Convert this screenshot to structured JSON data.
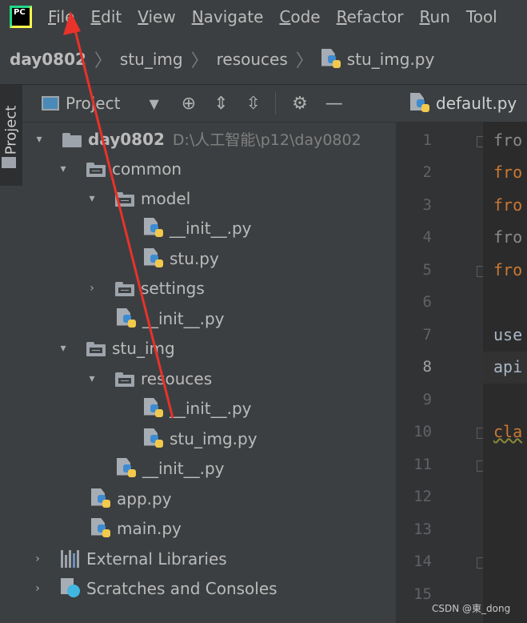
{
  "menubar": {
    "logo_text": "PC",
    "items": [
      {
        "mnemonic": "F",
        "rest": "ile"
      },
      {
        "mnemonic": "E",
        "rest": "dit"
      },
      {
        "mnemonic": "V",
        "rest": "iew"
      },
      {
        "mnemonic": "N",
        "rest": "avigate"
      },
      {
        "mnemonic": "C",
        "rest": "ode"
      },
      {
        "mnemonic": "R",
        "rest": "efactor"
      },
      {
        "mnemonic": "R",
        "rest": "un"
      },
      {
        "mnemonic": "",
        "rest": "Tool"
      }
    ]
  },
  "breadcrumb": [
    "day0802",
    "stu_img",
    "resouces",
    "stu_img.py"
  ],
  "sidebar_tab": "Project",
  "project_panel": {
    "title": "Project",
    "tools": [
      "dropdown-icon",
      "locate-icon",
      "expand-all-icon",
      "collapse-all-icon",
      "gear-icon",
      "hide-icon"
    ]
  },
  "tree": {
    "root_name": "day0802",
    "root_path": "D:\\人工智能\\p12\\day0802",
    "common": "common",
    "model": "model",
    "model_init": "__init__.py",
    "stu": "stu.py",
    "settings": "settings",
    "common_init": "__init__.py",
    "stu_img": "stu_img",
    "resouces": "resouces",
    "res_init": "__init__.py",
    "stu_img_py": "stu_img.py",
    "stu_img_init": "__init__.py",
    "app": "app.py",
    "main": "main.py",
    "ext_libs": "External Libraries",
    "scratches": "Scratches and Consoles"
  },
  "editor": {
    "tab": "default.py",
    "line_numbers": [
      "1",
      "2",
      "3",
      "4",
      "5",
      "6",
      "7",
      "8",
      "9",
      "10",
      "11",
      "12",
      "13",
      "14",
      "15"
    ],
    "lines": {
      "l1": "fro",
      "l2": "fro",
      "l3": "fro",
      "l4": "fro",
      "l5": "fro",
      "l7": "use",
      "l8": "api",
      "l10": "cla"
    }
  },
  "watermark": "CSDN @東_dong",
  "colors": {
    "annotation_arrow": "#e8322b",
    "keyword": "#cc7832",
    "background": "#2b2b2b"
  }
}
